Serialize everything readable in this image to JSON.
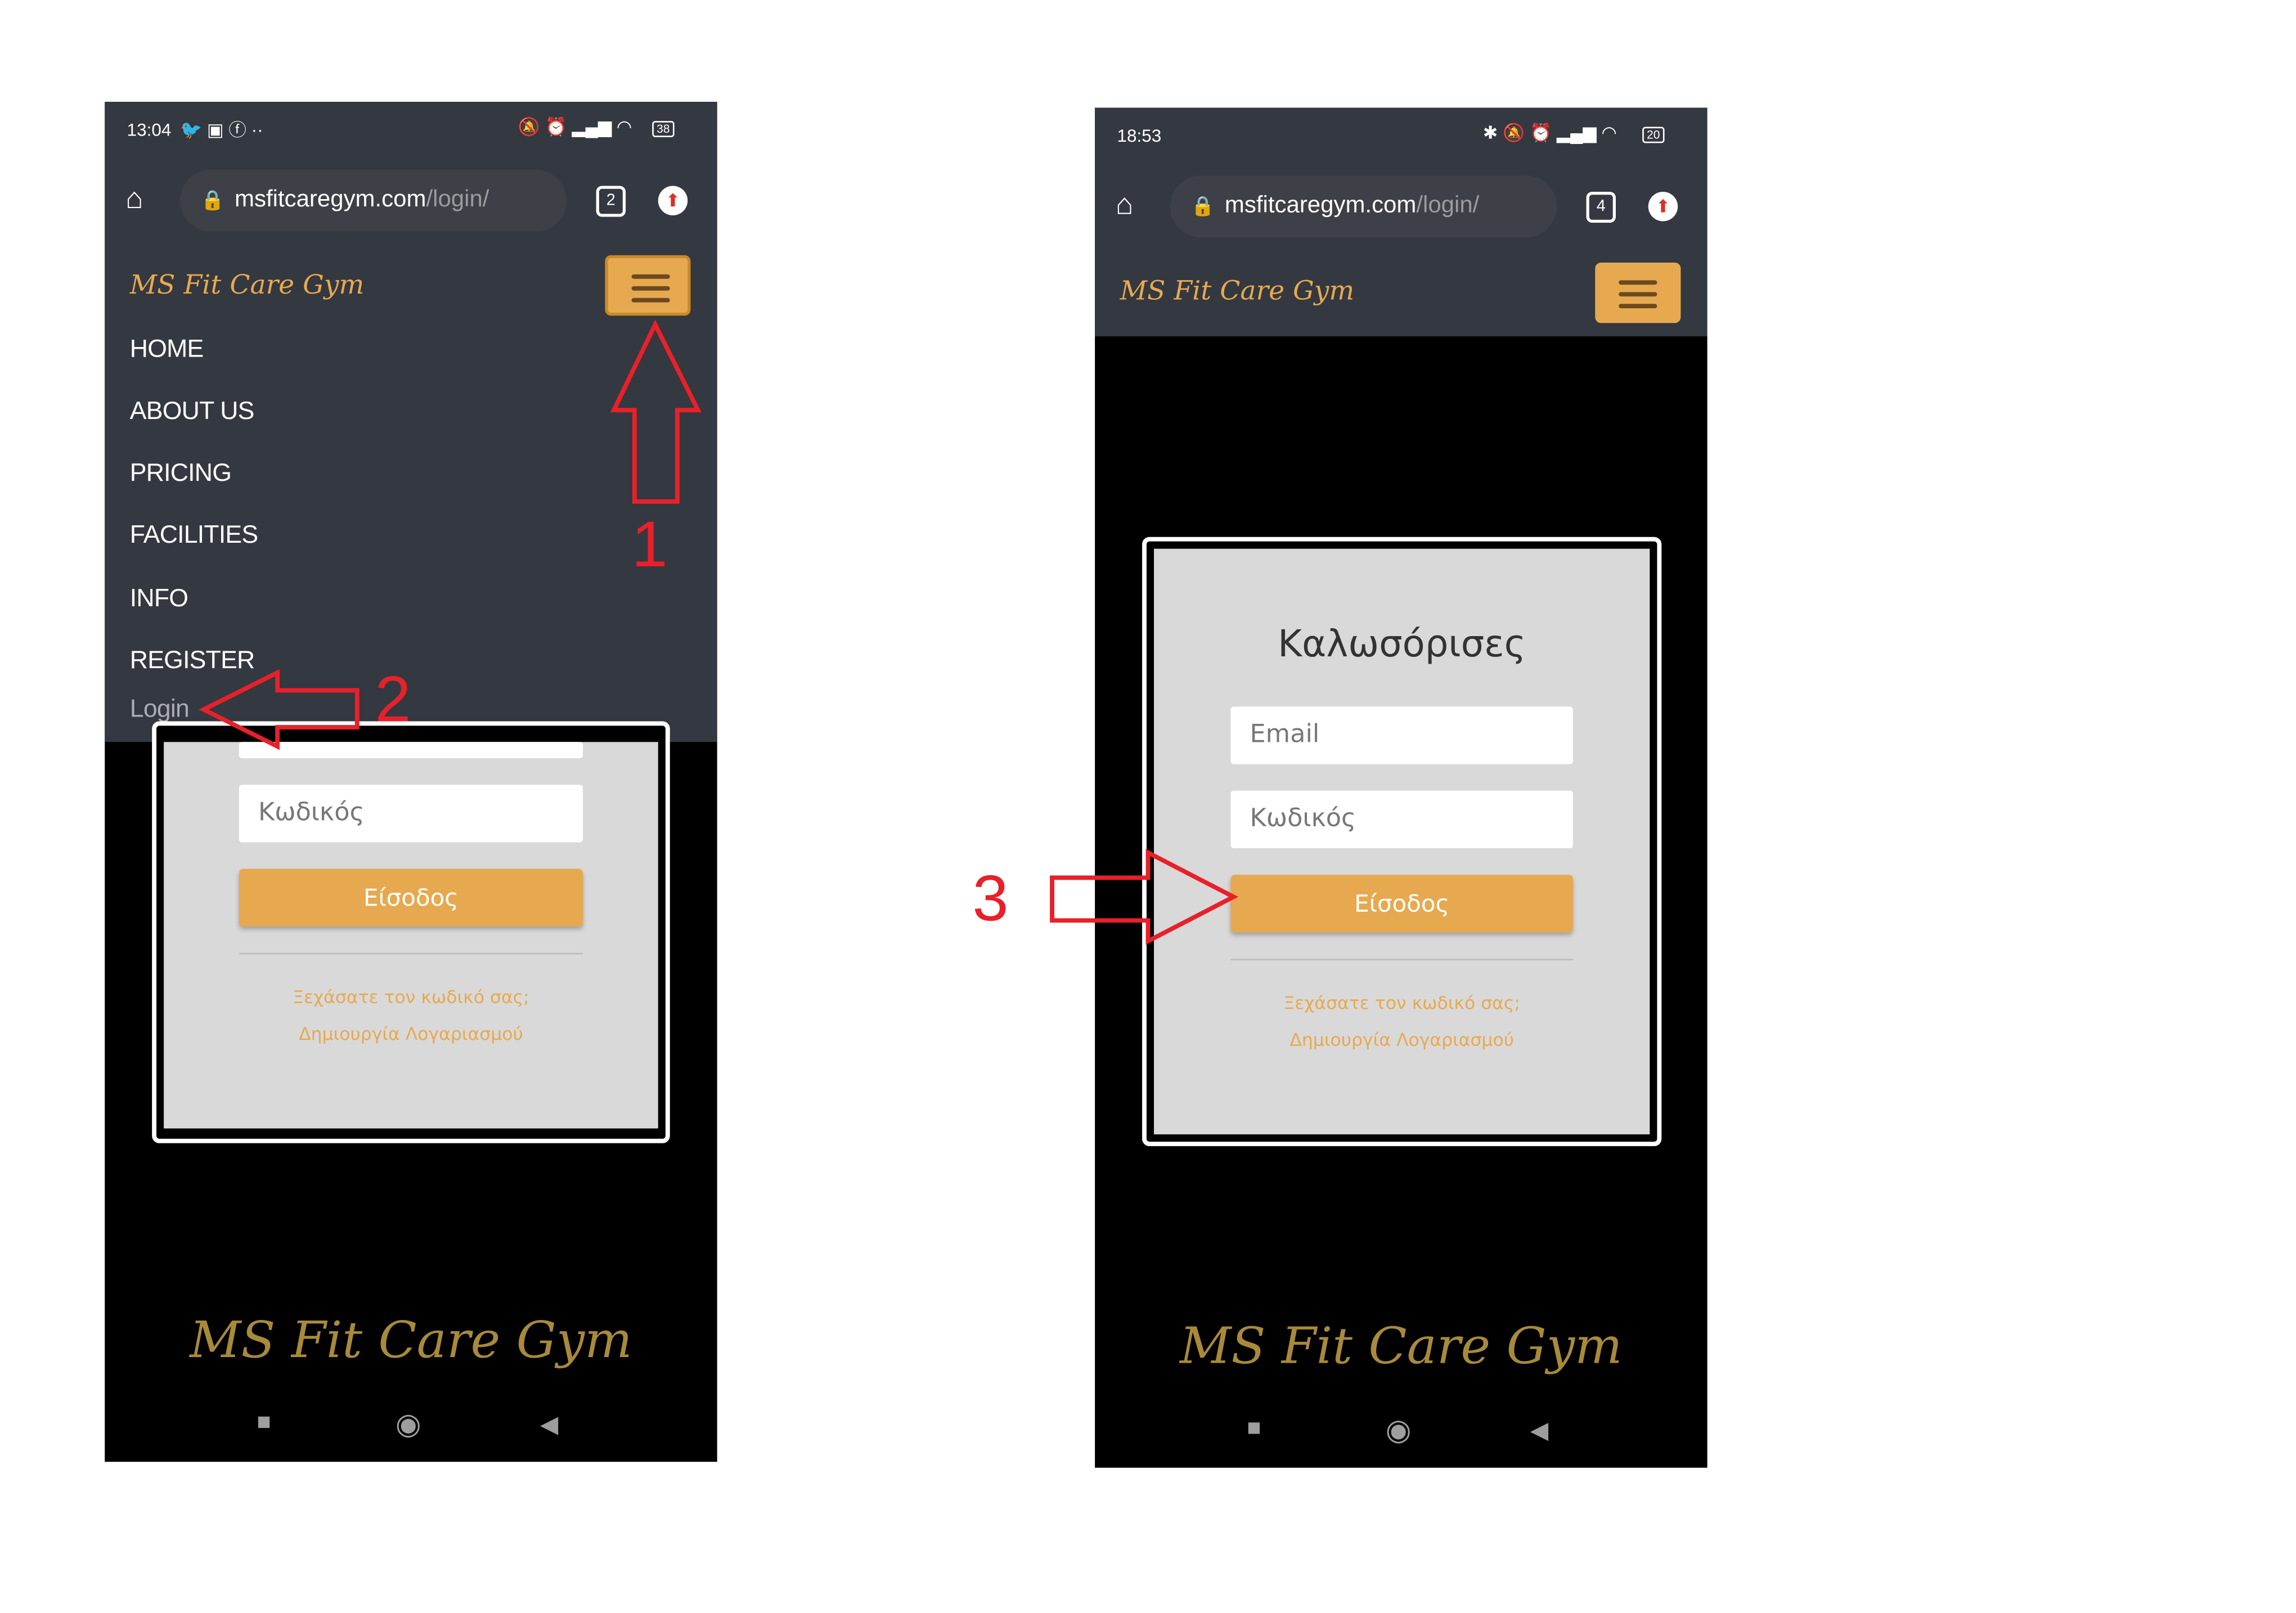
{
  "left_phone": {
    "status": {
      "time": "13:04",
      "battery": "38"
    },
    "url": {
      "host": "msfitcaregym.com",
      "path": "/login/"
    },
    "tab_count": "2",
    "brand": "MS Fit Care Gym",
    "menu": [
      "HOME",
      "ABOUT US",
      "PRICING",
      "FACILITIES",
      "INFO",
      "REGISTER",
      "Login"
    ],
    "form": {
      "password_placeholder": "Κωδικός",
      "submit": "Είσοδος",
      "forgot": "Ξεχάσατε τον κωδικό σας;",
      "create": "Δημιουργία Λογαριασμού"
    },
    "footer_logo": "MS Fit Care Gym"
  },
  "right_phone": {
    "status": {
      "time": "18:53",
      "battery": "20"
    },
    "url": {
      "host": "msfitcaregym.com",
      "path": "/login/"
    },
    "tab_count": "4",
    "brand": "MS Fit Care Gym",
    "form": {
      "title": "Καλωσόρισες",
      "email_placeholder": "Email",
      "password_placeholder": "Κωδικός",
      "submit": "Είσοδος",
      "forgot": "Ξεχάσατε τον κωδικό σας;",
      "create": "Δημιουργία Λογαριασμού"
    },
    "footer_logo": "MS Fit Care Gym"
  },
  "annotations": {
    "step1": "1",
    "step2": "2",
    "step3": "3",
    "color": "#e8202a"
  },
  "colors": {
    "accent": "#e7a94f",
    "header": "#343840"
  }
}
